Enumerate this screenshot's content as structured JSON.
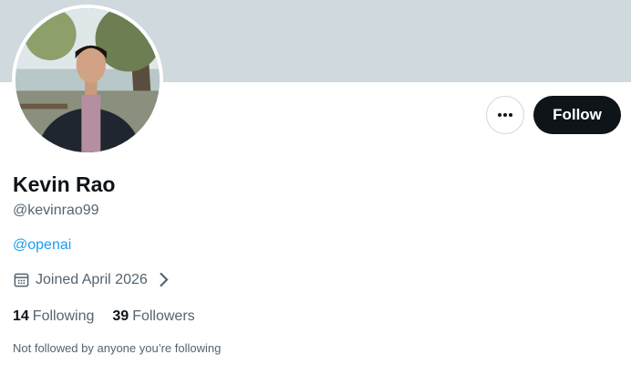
{
  "profile": {
    "name": "Kevin Rao",
    "handle": "@kevinrao99",
    "bio_link": "@openai",
    "joined": "Joined April 2026",
    "following_count": "14",
    "following_label": "Following",
    "followers_count": "39",
    "followers_label": "Followers",
    "social_note": "Not followed by anyone you’re following"
  },
  "actions": {
    "follow_label": "Follow",
    "more_icon": "more-horizontal-icon"
  },
  "colors": {
    "banner": "#cfd9de",
    "link": "#1d9bf0",
    "primary_button": "#0f1419",
    "secondary_text": "#536471"
  }
}
